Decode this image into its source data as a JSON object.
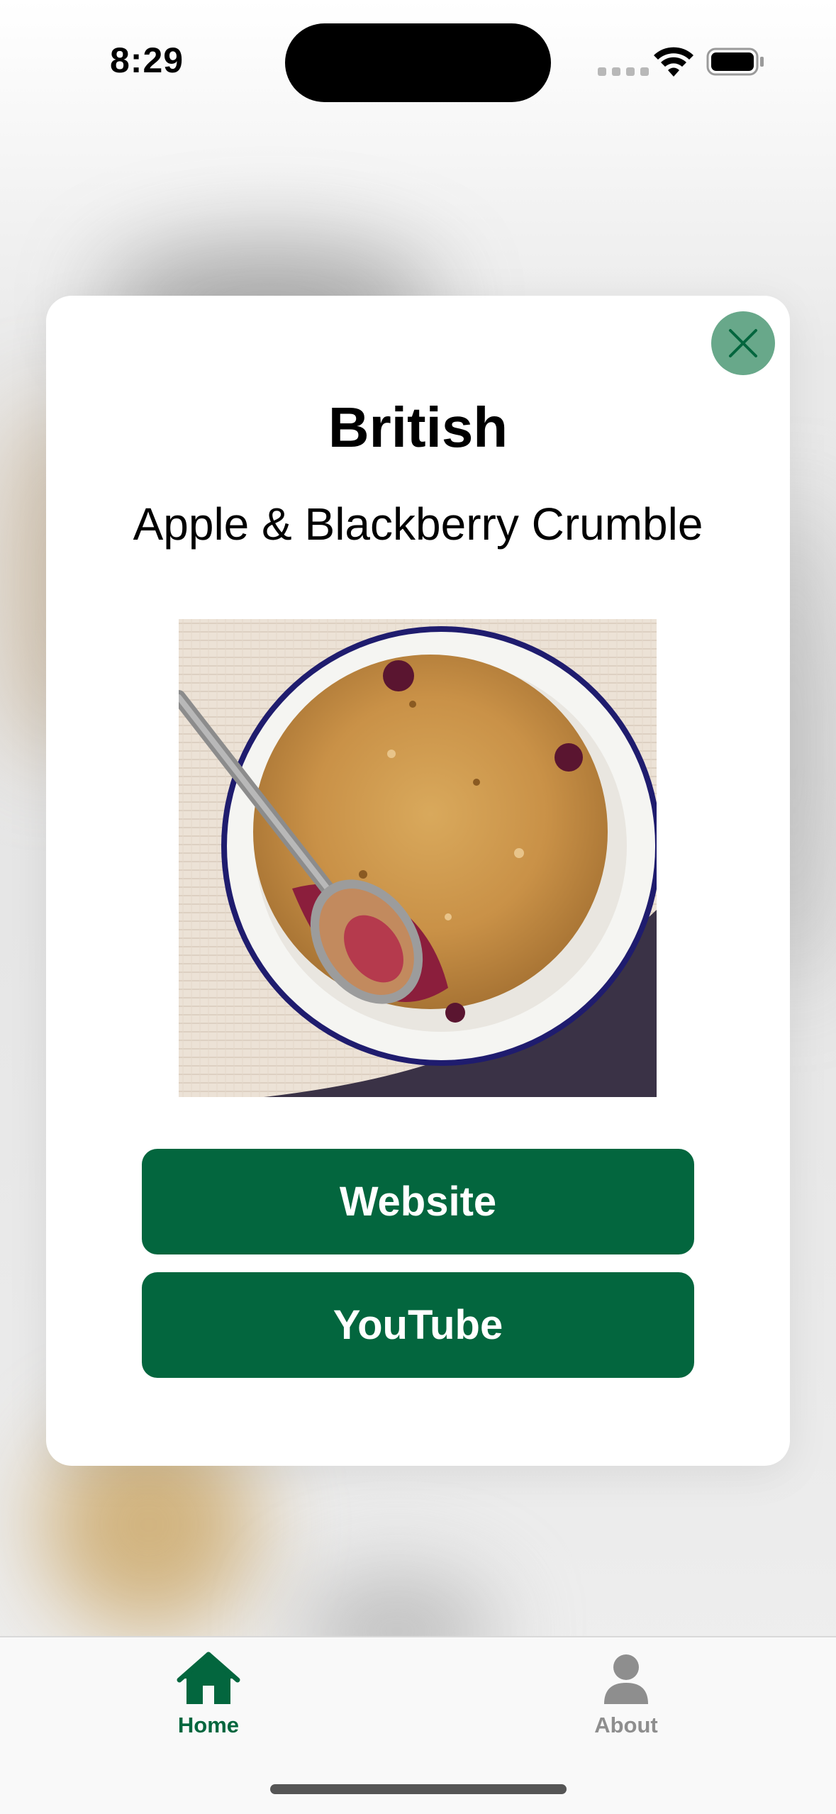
{
  "status_bar": {
    "time": "8:29"
  },
  "modal": {
    "category": "British",
    "meal_name": "Apple & Blackberry Crumble",
    "image_alt": "Apple & Blackberry Crumble photo",
    "buttons": {
      "website": "Website",
      "youtube": "YouTube"
    },
    "close_icon": "close-icon"
  },
  "tab_bar": {
    "tabs": [
      {
        "label": "Home",
        "icon": "house-icon",
        "selected": true
      },
      {
        "label": "About",
        "icon": "person-icon",
        "selected": false
      }
    ]
  },
  "colors": {
    "accent": "#03663e",
    "close_button": "#68a88a",
    "inactive_tab": "#8e8e8e"
  }
}
